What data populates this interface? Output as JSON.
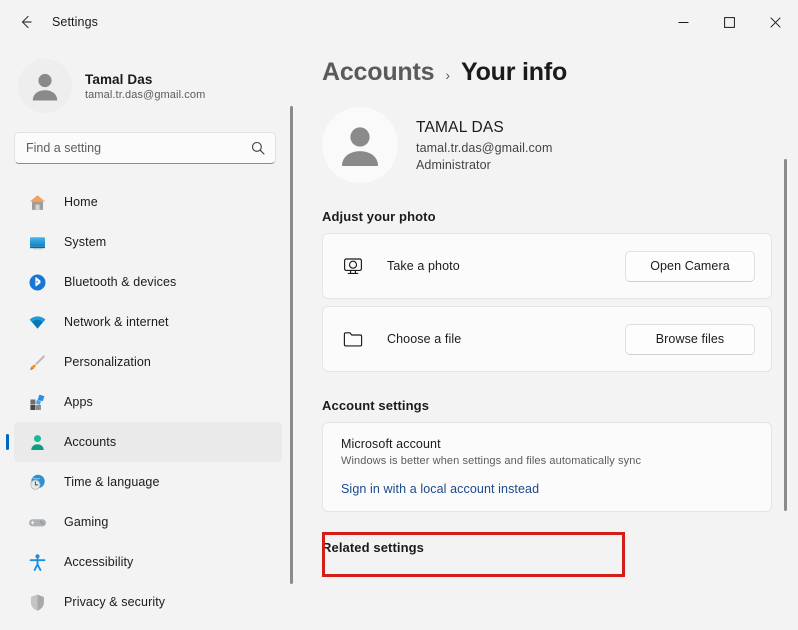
{
  "titlebar": {
    "back_label": "back-arrow",
    "app_title": "Settings",
    "minimize": "–",
    "maximize": "□",
    "close": "✕"
  },
  "sidebar": {
    "profile": {
      "name": "Tamal Das",
      "email": "tamal.tr.das@gmail.com",
      "avatar_icon": "person-avatar-icon"
    },
    "search": {
      "placeholder": "Find a setting",
      "value": "",
      "icon": "search-icon"
    },
    "items": [
      {
        "label": "Home",
        "icon": "home-icon",
        "active": false
      },
      {
        "label": "System",
        "icon": "system-monitor-icon",
        "active": false
      },
      {
        "label": "Bluetooth & devices",
        "icon": "bluetooth-icon",
        "active": false
      },
      {
        "label": "Network & internet",
        "icon": "wifi-icon",
        "active": false
      },
      {
        "label": "Personalization",
        "icon": "paintbrush-icon",
        "active": false
      },
      {
        "label": "Apps",
        "icon": "apps-icon",
        "active": false
      },
      {
        "label": "Accounts",
        "icon": "accounts-person-icon",
        "active": true
      },
      {
        "label": "Time & language",
        "icon": "clock-globe-icon",
        "active": false
      },
      {
        "label": "Gaming",
        "icon": "gamepad-icon",
        "active": false
      },
      {
        "label": "Accessibility",
        "icon": "accessibility-person-icon",
        "active": false
      },
      {
        "label": "Privacy & security",
        "icon": "shield-icon",
        "active": false
      }
    ]
  },
  "main": {
    "breadcrumb": {
      "parent": "Accounts",
      "separator": "›",
      "current": "Your info"
    },
    "account": {
      "avatar_icon": "person-avatar-icon",
      "name": "TAMAL DAS",
      "email": "tamal.tr.das@gmail.com",
      "role": "Administrator"
    },
    "adjust_photo": {
      "title": "Adjust your photo",
      "rows": [
        {
          "icon": "camera-icon",
          "label": "Take a photo",
          "button": "Open Camera"
        },
        {
          "icon": "folder-icon",
          "label": "Choose a file",
          "button": "Browse files"
        }
      ]
    },
    "account_settings": {
      "title": "Account settings",
      "ms_account_title": "Microsoft account",
      "ms_account_sub": "Windows is better when settings and files automatically sync",
      "local_account_link": "Sign in with a local account instead"
    },
    "related_settings": {
      "title": "Related settings"
    }
  },
  "colors": {
    "accent": "#0067c0",
    "highlight_box": "#d41f18",
    "link": "#1a4a8a",
    "window_bg": "#f3f3f3",
    "card_bg": "#fbfbfb"
  }
}
